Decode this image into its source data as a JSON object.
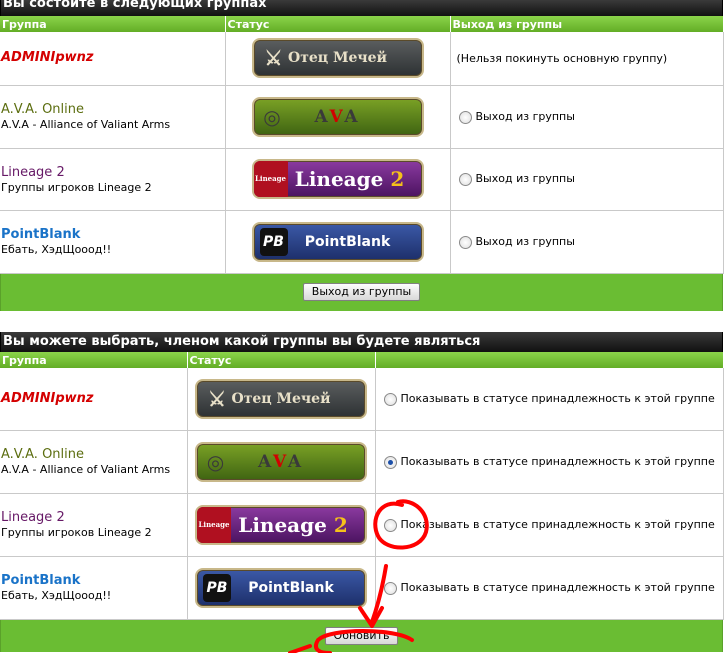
{
  "panel1": {
    "title": "Вы состоите в следующих группах",
    "headers": {
      "group": "Группа",
      "status": "Статус",
      "leave": "Выход из группы"
    },
    "rows": [
      {
        "name": "ADMINIpwnz",
        "desc": "",
        "badge": "Отец Мечей",
        "option": "(Нельзя покинуть основную группу)"
      },
      {
        "name": "A.V.A. Online",
        "desc": "A.V.A - Alliance of Valiant Arms",
        "badge": "AVA",
        "option": "Выход из группы"
      },
      {
        "name": "Lineage 2",
        "desc": "Группы игроков Lineage 2",
        "badge": "Lineage 2",
        "option": "Выход из группы"
      },
      {
        "name": "PointBlank",
        "desc": "Ебать, ХэдЩооод!!",
        "badge": "PointBlank",
        "option": "Выход из группы"
      }
    ],
    "button": "Выход из группы"
  },
  "panel2": {
    "title": "Вы можете выбрать, членом какой группы вы будете являться",
    "headers": {
      "group": "Группа",
      "status": "Статус"
    },
    "rows": [
      {
        "name": "ADMINIpwnz",
        "desc": "",
        "badge": "Отец Мечей",
        "option": "Показывать в статусе принадлежность к этой группе",
        "checked": false
      },
      {
        "name": "A.V.A. Online",
        "desc": "A.V.A - Alliance of Valiant Arms",
        "badge": "AVA",
        "option": "Показывать в статусе принадлежность к этой группе",
        "checked": true
      },
      {
        "name": "Lineage 2",
        "desc": "Группы игроков Lineage 2",
        "badge": "Lineage 2",
        "option": "Показывать в статусе принадлежность к этой группе",
        "checked": false
      },
      {
        "name": "PointBlank",
        "desc": "Ебать, ХэдЩооод!!",
        "badge": "PointBlank",
        "option": "Показывать в статусе принадлежность к этой группе",
        "checked": false
      }
    ],
    "button": "Обновить"
  },
  "badges": {
    "sword_text": "Отец Мечей",
    "ava_a1": "A",
    "ava_v": "V",
    "ava_a2": "A",
    "lineage_text": "Lineage",
    "lineage_num": "2",
    "lineage_logo": "Lineage",
    "pb_text": "PointBlank",
    "pb_logo": "PB"
  },
  "icons": {
    "sword": "crossed-swords-icon",
    "ava": "ava-ring-icon",
    "pb": "pb-logo-icon"
  },
  "colors": {
    "title_bar": "#1a1a1a",
    "header_green": "#6fbb34",
    "footer_green": "#6abd33",
    "admin_red": "#d40000",
    "annotation_red": "#ff0000"
  }
}
